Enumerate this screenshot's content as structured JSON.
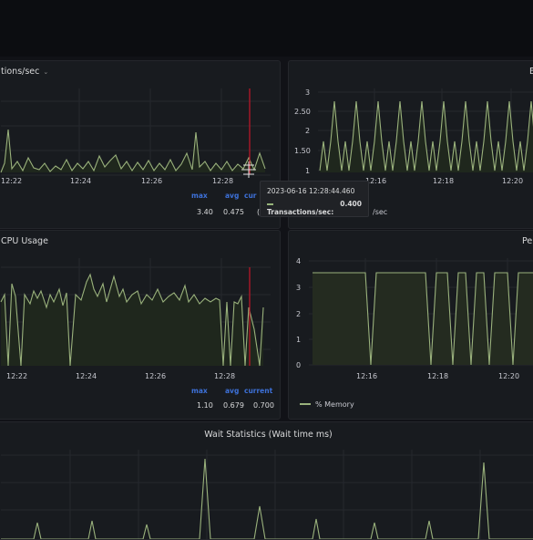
{
  "colors": {
    "series": "#9ab27c",
    "series_fill": "#2b3325",
    "grid": "#26282e",
    "cursor": "#c4162a",
    "legend_header": "#3d71d9"
  },
  "panels": {
    "transactions": {
      "title": "tions/sec",
      "x_ticks": [
        "12:22",
        "12:24",
        "12:26",
        "12:28"
      ],
      "legend_headers": {
        "max": "max",
        "avg": "avg",
        "current": "cur"
      },
      "legend_values": {
        "max": "3.40",
        "avg": "0.475",
        "current": "("
      }
    },
    "top_right": {
      "title": "E",
      "y_ticks": [
        "3",
        "2.50",
        "2",
        "1.50",
        "1"
      ],
      "x_ticks": [
        "12:16",
        "12:18",
        "12:20"
      ],
      "legend_fragment": "/sec"
    },
    "cpu": {
      "title": "CPU Usage",
      "x_ticks": [
        "12:22",
        "12:24",
        "12:26",
        "12:28"
      ],
      "legend_headers": {
        "max": "max",
        "avg": "avg",
        "current": "current"
      },
      "legend_values": {
        "max": "1.10",
        "avg": "0.679",
        "current": "0.700"
      }
    },
    "memory": {
      "title": "Pe",
      "y_ticks": [
        "4",
        "3",
        "2",
        "1",
        "0"
      ],
      "x_ticks": [
        "12:16",
        "12:18",
        "12:20"
      ],
      "legend_label": "% Memory"
    },
    "wait": {
      "title": "Wait Statistics (Wait time ms)"
    }
  },
  "tooltip": {
    "timestamp": "2023-06-16 12:28:44.460",
    "series_name": "Transactions/sec:",
    "value": "0.400"
  }
}
